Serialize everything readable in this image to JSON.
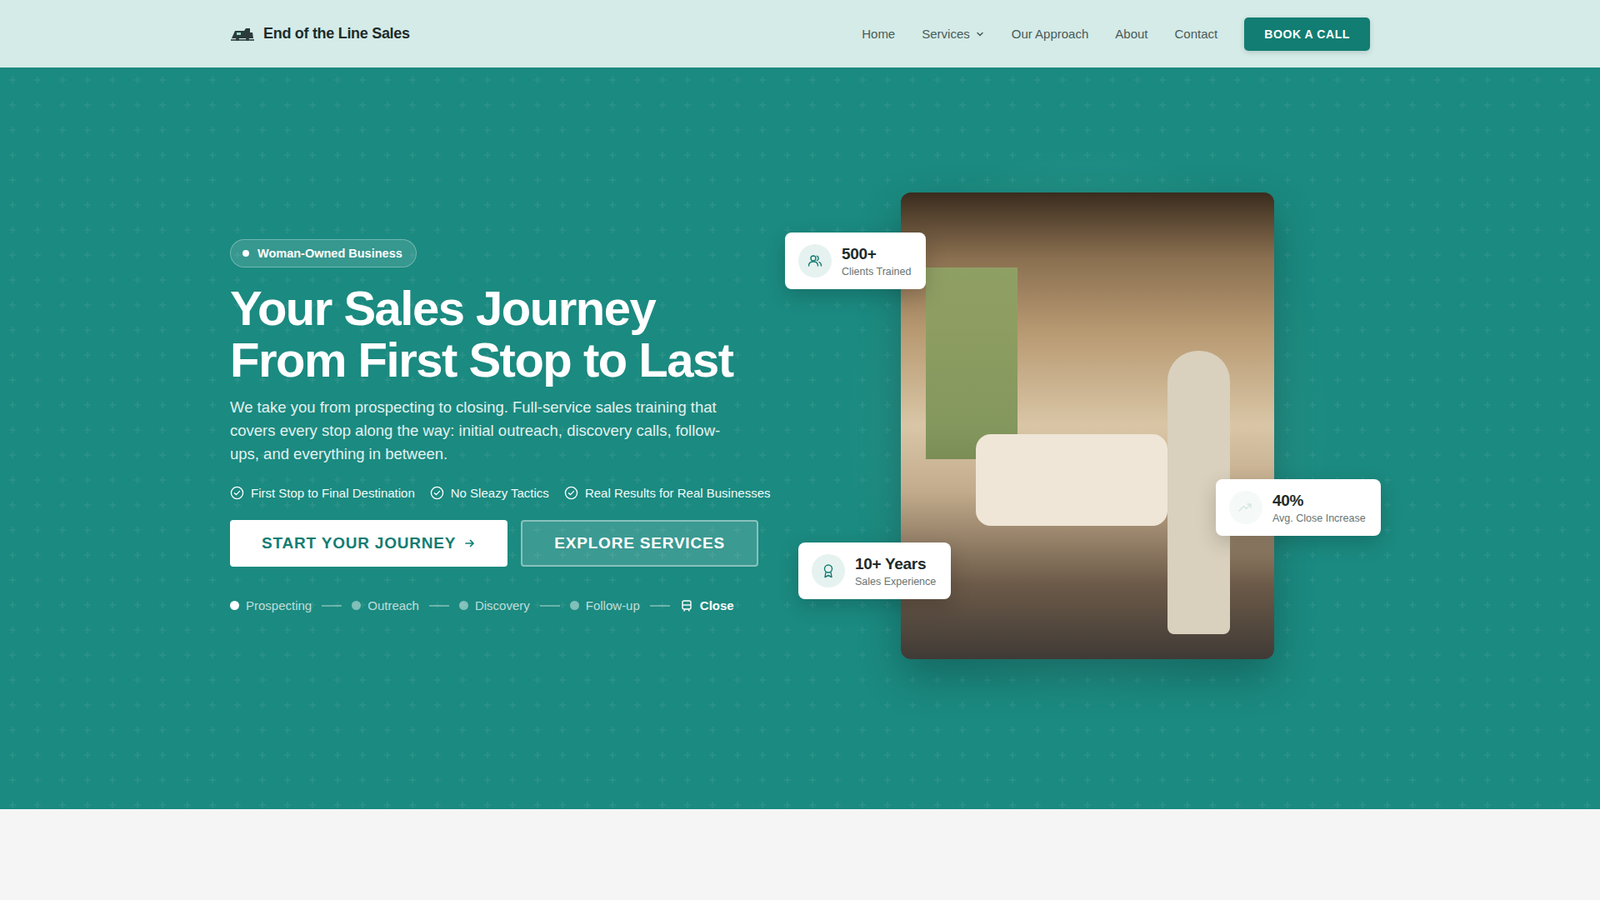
{
  "nav": {
    "logo": "End of the Line Sales",
    "links": [
      {
        "label": "Home",
        "dropdown": false
      },
      {
        "label": "Services",
        "dropdown": true
      },
      {
        "label": "Our Approach",
        "dropdown": false
      },
      {
        "label": "About",
        "dropdown": false
      },
      {
        "label": "Contact",
        "dropdown": false
      }
    ],
    "cta": "BOOK A CALL"
  },
  "hero": {
    "badge": "Woman-Owned Business",
    "title_lines": [
      "Your Sales Journey",
      "From First Stop to Last"
    ],
    "description": "We take you from prospecting to closing. Full-service sales training that covers every stop along the way: initial outreach, discovery calls, follow-ups, and everything in between.",
    "checks": [
      "First Stop to Final Destination",
      "No Sleazy Tactics",
      "Real Results for Real Businesses"
    ],
    "buttons": {
      "primary": "START YOUR JOURNEY",
      "secondary": "EXPLORE SERVICES"
    },
    "stops": [
      {
        "label": "Prospecting",
        "kind": "start"
      },
      {
        "label": "Outreach",
        "kind": "stop"
      },
      {
        "label": "Discovery",
        "kind": "stop"
      },
      {
        "label": "Follow-up",
        "kind": "stop"
      },
      {
        "label": "Close",
        "kind": "final"
      }
    ],
    "stats": [
      {
        "value": "500+",
        "label": "Clients Trained",
        "kind": "clients"
      },
      {
        "value": "40%",
        "label": "Avg. Close Increase",
        "kind": "growth"
      },
      {
        "value": "10+ Years",
        "label": "Sales Experience",
        "kind": "experience"
      }
    ]
  }
}
